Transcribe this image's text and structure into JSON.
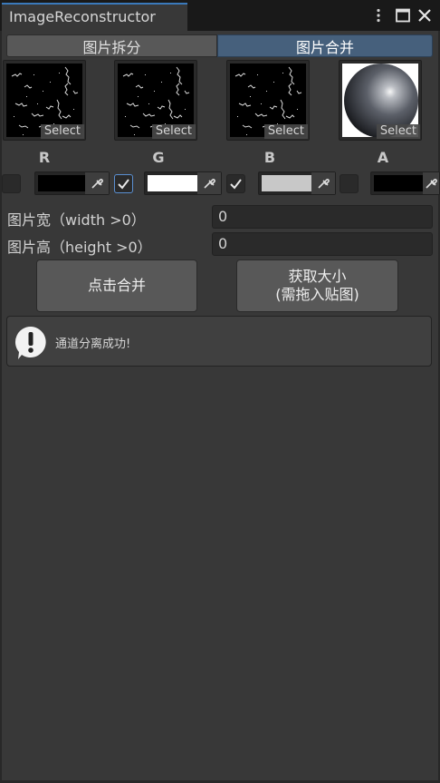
{
  "window": {
    "title": "ImageReconstructor",
    "menu_icon": "kebab-menu-icon",
    "maximize_icon": "maximize-icon",
    "close_icon": "close-icon"
  },
  "mode_toggle": {
    "options": [
      "图片拆分",
      "图片合并"
    ],
    "selected": "图片合并"
  },
  "slots": [
    {
      "channel": "R",
      "thumbnail": "noise-texture",
      "select_label": "Select"
    },
    {
      "channel": "G",
      "thumbnail": "noise-texture",
      "select_label": "Select"
    },
    {
      "channel": "B",
      "thumbnail": "noise-texture",
      "select_label": "Select"
    },
    {
      "channel": "A",
      "thumbnail": "sphere-texture",
      "select_label": "Select"
    }
  ],
  "channels": [
    {
      "checked": false,
      "color": "#000000"
    },
    {
      "checked": true,
      "color": "#ffffff",
      "focused": true
    },
    {
      "checked": true,
      "color": "#c8c8c8"
    },
    {
      "checked": false,
      "color": "#000000"
    }
  ],
  "fields": {
    "width_label": "图片宽（width >0）",
    "width_value": "0",
    "height_label": "图片高（height >0）",
    "height_value": "0"
  },
  "buttons": {
    "merge": "点击合并",
    "get_size_line1": "获取大小",
    "get_size_line2": "(需拖入贴图)"
  },
  "help": {
    "icon": "info-exclamation-icon",
    "message": "通道分离成功!"
  },
  "colors": {
    "accent": "#3a79bb",
    "selected_tab": "#46607c",
    "panel": "#383838"
  }
}
